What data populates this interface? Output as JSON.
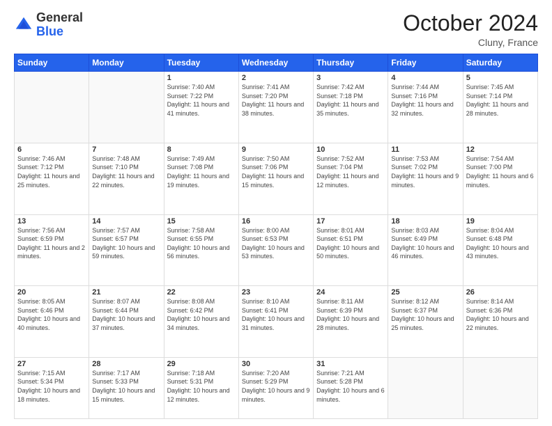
{
  "header": {
    "logo_general": "General",
    "logo_blue": "Blue",
    "month_title": "October 2024",
    "location": "Cluny, France"
  },
  "weekdays": [
    "Sunday",
    "Monday",
    "Tuesday",
    "Wednesday",
    "Thursday",
    "Friday",
    "Saturday"
  ],
  "weeks": [
    [
      {
        "day": "",
        "info": ""
      },
      {
        "day": "",
        "info": ""
      },
      {
        "day": "1",
        "info": "Sunrise: 7:40 AM\nSunset: 7:22 PM\nDaylight: 11 hours and 41 minutes."
      },
      {
        "day": "2",
        "info": "Sunrise: 7:41 AM\nSunset: 7:20 PM\nDaylight: 11 hours and 38 minutes."
      },
      {
        "day": "3",
        "info": "Sunrise: 7:42 AM\nSunset: 7:18 PM\nDaylight: 11 hours and 35 minutes."
      },
      {
        "day": "4",
        "info": "Sunrise: 7:44 AM\nSunset: 7:16 PM\nDaylight: 11 hours and 32 minutes."
      },
      {
        "day": "5",
        "info": "Sunrise: 7:45 AM\nSunset: 7:14 PM\nDaylight: 11 hours and 28 minutes."
      }
    ],
    [
      {
        "day": "6",
        "info": "Sunrise: 7:46 AM\nSunset: 7:12 PM\nDaylight: 11 hours and 25 minutes."
      },
      {
        "day": "7",
        "info": "Sunrise: 7:48 AM\nSunset: 7:10 PM\nDaylight: 11 hours and 22 minutes."
      },
      {
        "day": "8",
        "info": "Sunrise: 7:49 AM\nSunset: 7:08 PM\nDaylight: 11 hours and 19 minutes."
      },
      {
        "day": "9",
        "info": "Sunrise: 7:50 AM\nSunset: 7:06 PM\nDaylight: 11 hours and 15 minutes."
      },
      {
        "day": "10",
        "info": "Sunrise: 7:52 AM\nSunset: 7:04 PM\nDaylight: 11 hours and 12 minutes."
      },
      {
        "day": "11",
        "info": "Sunrise: 7:53 AM\nSunset: 7:02 PM\nDaylight: 11 hours and 9 minutes."
      },
      {
        "day": "12",
        "info": "Sunrise: 7:54 AM\nSunset: 7:00 PM\nDaylight: 11 hours and 6 minutes."
      }
    ],
    [
      {
        "day": "13",
        "info": "Sunrise: 7:56 AM\nSunset: 6:59 PM\nDaylight: 11 hours and 2 minutes."
      },
      {
        "day": "14",
        "info": "Sunrise: 7:57 AM\nSunset: 6:57 PM\nDaylight: 10 hours and 59 minutes."
      },
      {
        "day": "15",
        "info": "Sunrise: 7:58 AM\nSunset: 6:55 PM\nDaylight: 10 hours and 56 minutes."
      },
      {
        "day": "16",
        "info": "Sunrise: 8:00 AM\nSunset: 6:53 PM\nDaylight: 10 hours and 53 minutes."
      },
      {
        "day": "17",
        "info": "Sunrise: 8:01 AM\nSunset: 6:51 PM\nDaylight: 10 hours and 50 minutes."
      },
      {
        "day": "18",
        "info": "Sunrise: 8:03 AM\nSunset: 6:49 PM\nDaylight: 10 hours and 46 minutes."
      },
      {
        "day": "19",
        "info": "Sunrise: 8:04 AM\nSunset: 6:48 PM\nDaylight: 10 hours and 43 minutes."
      }
    ],
    [
      {
        "day": "20",
        "info": "Sunrise: 8:05 AM\nSunset: 6:46 PM\nDaylight: 10 hours and 40 minutes."
      },
      {
        "day": "21",
        "info": "Sunrise: 8:07 AM\nSunset: 6:44 PM\nDaylight: 10 hours and 37 minutes."
      },
      {
        "day": "22",
        "info": "Sunrise: 8:08 AM\nSunset: 6:42 PM\nDaylight: 10 hours and 34 minutes."
      },
      {
        "day": "23",
        "info": "Sunrise: 8:10 AM\nSunset: 6:41 PM\nDaylight: 10 hours and 31 minutes."
      },
      {
        "day": "24",
        "info": "Sunrise: 8:11 AM\nSunset: 6:39 PM\nDaylight: 10 hours and 28 minutes."
      },
      {
        "day": "25",
        "info": "Sunrise: 8:12 AM\nSunset: 6:37 PM\nDaylight: 10 hours and 25 minutes."
      },
      {
        "day": "26",
        "info": "Sunrise: 8:14 AM\nSunset: 6:36 PM\nDaylight: 10 hours and 22 minutes."
      }
    ],
    [
      {
        "day": "27",
        "info": "Sunrise: 7:15 AM\nSunset: 5:34 PM\nDaylight: 10 hours and 18 minutes."
      },
      {
        "day": "28",
        "info": "Sunrise: 7:17 AM\nSunset: 5:33 PM\nDaylight: 10 hours and 15 minutes."
      },
      {
        "day": "29",
        "info": "Sunrise: 7:18 AM\nSunset: 5:31 PM\nDaylight: 10 hours and 12 minutes."
      },
      {
        "day": "30",
        "info": "Sunrise: 7:20 AM\nSunset: 5:29 PM\nDaylight: 10 hours and 9 minutes."
      },
      {
        "day": "31",
        "info": "Sunrise: 7:21 AM\nSunset: 5:28 PM\nDaylight: 10 hours and 6 minutes."
      },
      {
        "day": "",
        "info": ""
      },
      {
        "day": "",
        "info": ""
      }
    ]
  ]
}
